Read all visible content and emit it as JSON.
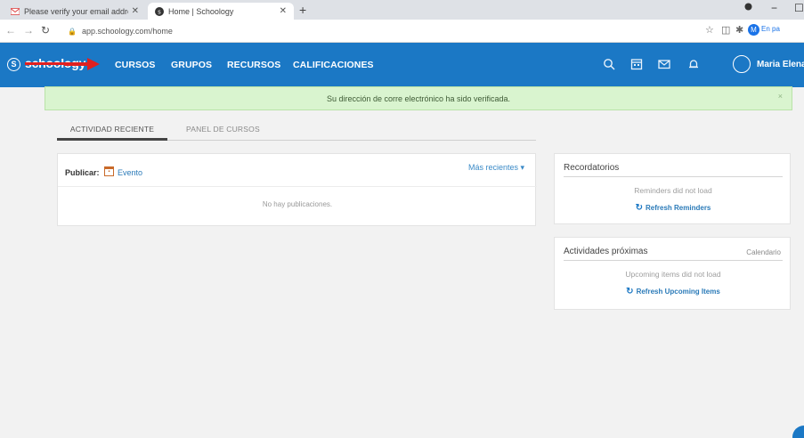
{
  "browser": {
    "tabs": [
      {
        "title": "Please verify your email addres",
        "favicon": "gmail-icon"
      },
      {
        "title": "Home | Schoology",
        "favicon": "schoology-icon"
      }
    ],
    "new_tab": "+",
    "url": "app.schoology.com/home",
    "profile_initial": "M",
    "profile_label": "En pa",
    "window_controls": [
      "−",
      "☐"
    ]
  },
  "header": {
    "logo_text": "schoology",
    "nav": [
      "CURSOS",
      "GRUPOS",
      "RECURSOS",
      "CALIFICACIONES"
    ],
    "user_name": "Maria Elena",
    "brand_color": "#1b78c5"
  },
  "banner": {
    "message": "Su dirección de corre electrónico ha sido verificada.",
    "close": "×"
  },
  "tabs": {
    "recent": "ACTIVIDAD RECIENTE",
    "courses": "PANEL DE CURSOS"
  },
  "feed": {
    "publish_label": "Publicar:",
    "event_label": "Evento",
    "sort_label": "Más recientes ▾",
    "empty": "No hay publicaciones."
  },
  "reminders": {
    "title": "Recordatorios",
    "message": "Reminders did not load",
    "refresh": "Refresh Reminders"
  },
  "upcoming": {
    "title": "Actividades próximas",
    "calendar": "Calendario",
    "message": "Upcoming items did not load",
    "refresh": "Refresh Upcoming Items"
  }
}
